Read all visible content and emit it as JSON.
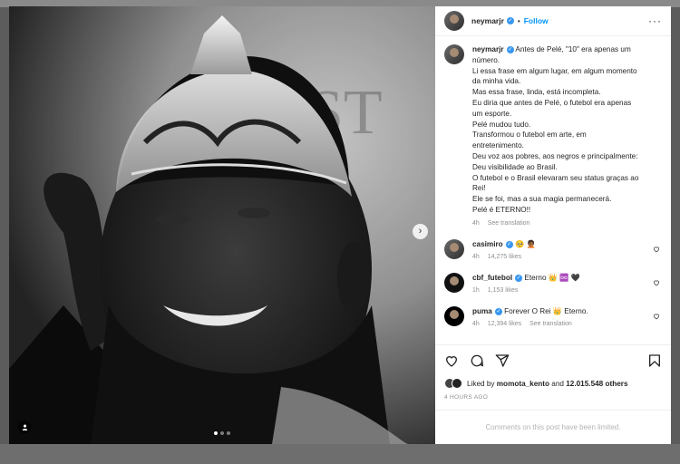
{
  "colors": {
    "accent": "#0095f6",
    "verified": "#3897f0",
    "muted": "#8e8e8e"
  },
  "media": {
    "next_icon": "chevron-right-icon",
    "tag_icon": "user-tag-icon",
    "carousel": {
      "count": 3,
      "active_index": 0
    }
  },
  "header": {
    "username": "neymarjr",
    "separator": "•",
    "follow_label": "Follow",
    "more_icon": "more-options-icon"
  },
  "caption": {
    "username": "neymarjr",
    "lines": [
      "Antes de Pelé, \"10\" era apenas um",
      "número.",
      "Li essa frase em algum lugar, em algum momento",
      "da minha vida.",
      "Mas essa frase, linda, está incompleta.",
      "Eu diria que antes de Pelé, o futebol era apenas",
      "um esporte.",
      "Pelé mudou tudo.",
      "Transformou o futebol em arte, em",
      "entretenimento.",
      "Deu voz aos pobres, aos negros e principalmente:",
      "Deu visibilidade ao Brasil.",
      "O futebol e o Brasil elevaram seu status graças ao",
      "Rei!",
      "Ele se foi, mas a sua magia permanecerá.",
      "Pelé é ETERNO!!"
    ],
    "age": "4h",
    "translate": "See translation"
  },
  "comments": [
    {
      "username": "casimiro",
      "text": "🥺 🤦🏾",
      "age": "4h",
      "likes": "14,275 likes",
      "translate": ""
    },
    {
      "username": "cbf_futebol",
      "text": "Eterno 👑 ♾️ 🖤",
      "age": "1h",
      "likes": "1,153 likes",
      "translate": ""
    },
    {
      "username": "puma",
      "text": "Forever O Rei 👑 Eterno.",
      "age": "4h",
      "likes": "12,394 likes",
      "translate": "See translation"
    }
  ],
  "actions": {
    "like_icon": "heart-icon",
    "comment_icon": "comment-icon",
    "share_icon": "share-icon",
    "save_icon": "bookmark-icon"
  },
  "likes": {
    "prefix": "Liked by",
    "user": "momota_kento",
    "middle": "and",
    "count": "12.015.548 others"
  },
  "timestamp": "4 HOURS AGO",
  "comments_limited": "Comments on this post have been limited."
}
